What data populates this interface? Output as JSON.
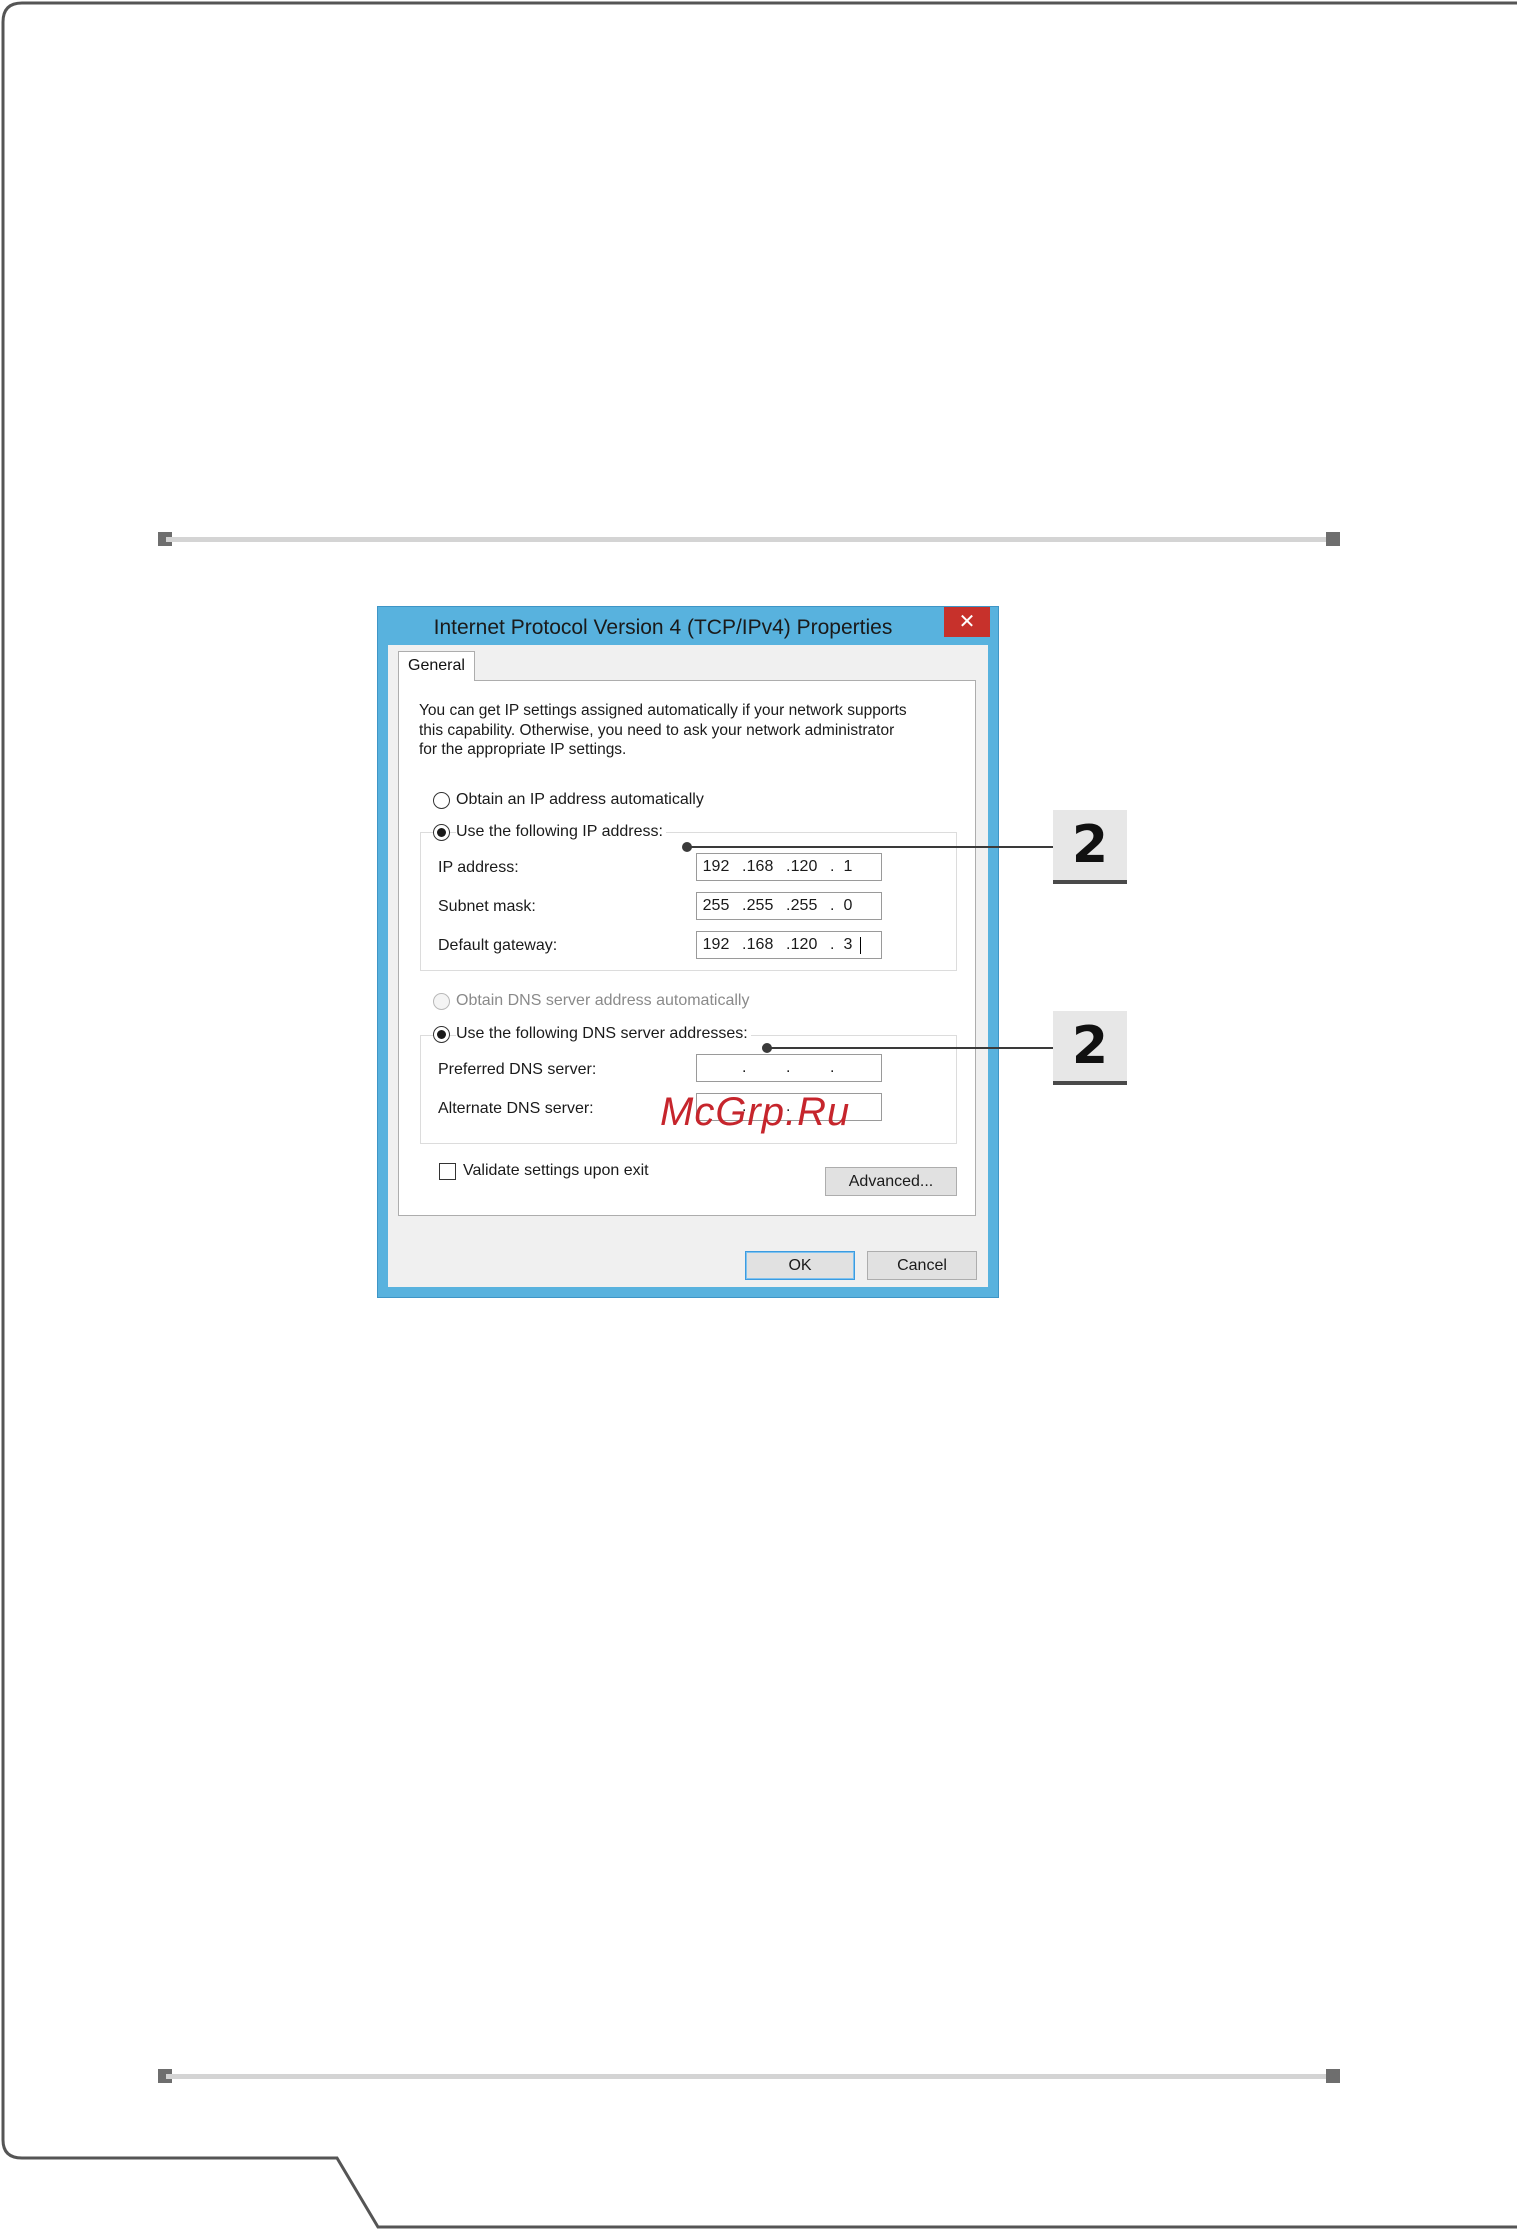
{
  "dialog": {
    "title": "Internet Protocol Version 4 (TCP/IPv4) Properties",
    "close_glyph": "✕",
    "tab_label": "General",
    "intro_lines": [
      "You can get IP settings assigned automatically if your network supports",
      "this capability. Otherwise, you need to ask your network administrator",
      "for the appropriate IP settings."
    ],
    "ip_section": {
      "auto_label": "Obtain an IP address automatically",
      "manual_label": "Use the following IP address:",
      "selected": "manual",
      "fields": [
        {
          "label": "IP address:",
          "octets": [
            "192",
            "168",
            "120",
            "1"
          ]
        },
        {
          "label": "Subnet mask:",
          "octets": [
            "255",
            "255",
            "255",
            "0"
          ]
        },
        {
          "label": "Default gateway:",
          "octets": [
            "192",
            "168",
            "120",
            "3"
          ]
        }
      ]
    },
    "dns_section": {
      "auto_label": "Obtain DNS server address automatically",
      "manual_label": "Use the following DNS server addresses:",
      "selected": "manual",
      "fields": [
        {
          "label": "Preferred DNS server:",
          "octets": [
            "",
            "",
            "",
            ""
          ]
        },
        {
          "label": "Alternate DNS server:",
          "octets": [
            "",
            "",
            "",
            ""
          ]
        }
      ]
    },
    "validate_label": "Validate settings upon exit",
    "validate_checked": false,
    "advanced_label": "Advanced...",
    "ok_label": "OK",
    "cancel_label": "Cancel"
  },
  "callouts": [
    {
      "number": "2"
    },
    {
      "number": "2"
    }
  ],
  "watermark": "McGrp.Ru",
  "colors": {
    "title_bar": "#58b2de",
    "close_button": "#c7312b",
    "callout_badge": "#e7e7e7",
    "watermark": "#c6252c"
  }
}
